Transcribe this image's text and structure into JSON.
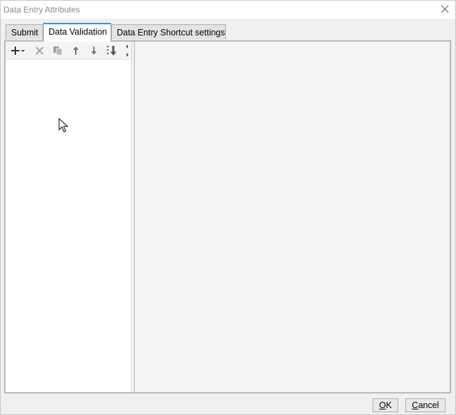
{
  "window": {
    "title": "Data Entry Attributes",
    "close_icon": "close-icon"
  },
  "tabs": [
    {
      "label": "Submit",
      "active": false
    },
    {
      "label": "Data Validation",
      "active": true
    },
    {
      "label": "Data Entry Shortcut settings",
      "active": false
    }
  ],
  "toolbar": {
    "icons": [
      "add-icon",
      "dropdown-arrow-icon",
      "delete-icon",
      "copy-icon",
      "move-up-icon",
      "move-down-icon",
      "move-to-bottom-icon",
      "more-icon"
    ]
  },
  "buttons": {
    "ok_accel": "O",
    "ok_rest": "K",
    "cancel_accel": "C",
    "cancel_rest": "ancel"
  },
  "colors": {
    "active_tab_accent": "#3c8fdb",
    "panel_background": "#f4f4f2"
  }
}
